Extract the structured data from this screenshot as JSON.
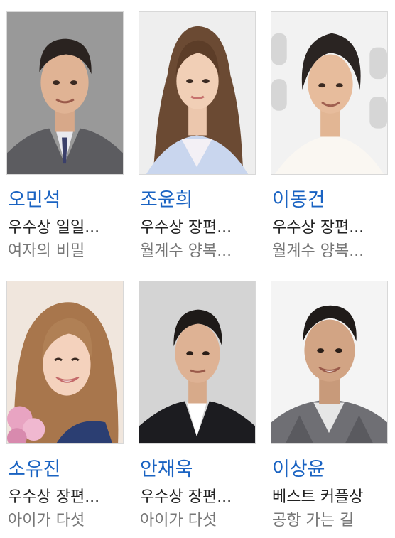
{
  "people": [
    {
      "name": "오민석",
      "award": "우수상 일일...",
      "work": "여자의 비밀",
      "photo_desc": "man-gray-suit"
    },
    {
      "name": "조윤희",
      "award": "우수상 장편...",
      "work": "월계수 양복...",
      "photo_desc": "woman-long-hair"
    },
    {
      "name": "이동건",
      "award": "우수상 장편...",
      "work": "월계수 양복...",
      "photo_desc": "man-white-shirt"
    },
    {
      "name": "소유진",
      "award": "우수상 장편...",
      "work": "아이가 다섯",
      "photo_desc": "woman-smiling"
    },
    {
      "name": "안재욱",
      "award": "우수상 장편...",
      "work": "아이가 다섯",
      "photo_desc": "man-dark-suit"
    },
    {
      "name": "이상윤",
      "award": "베스트 커플상",
      "work": "공항 가는 길",
      "photo_desc": "man-plaid-shirt"
    }
  ],
  "colors": {
    "name_link": "#1a63c2",
    "award_text": "#222222",
    "work_text": "#777777"
  }
}
